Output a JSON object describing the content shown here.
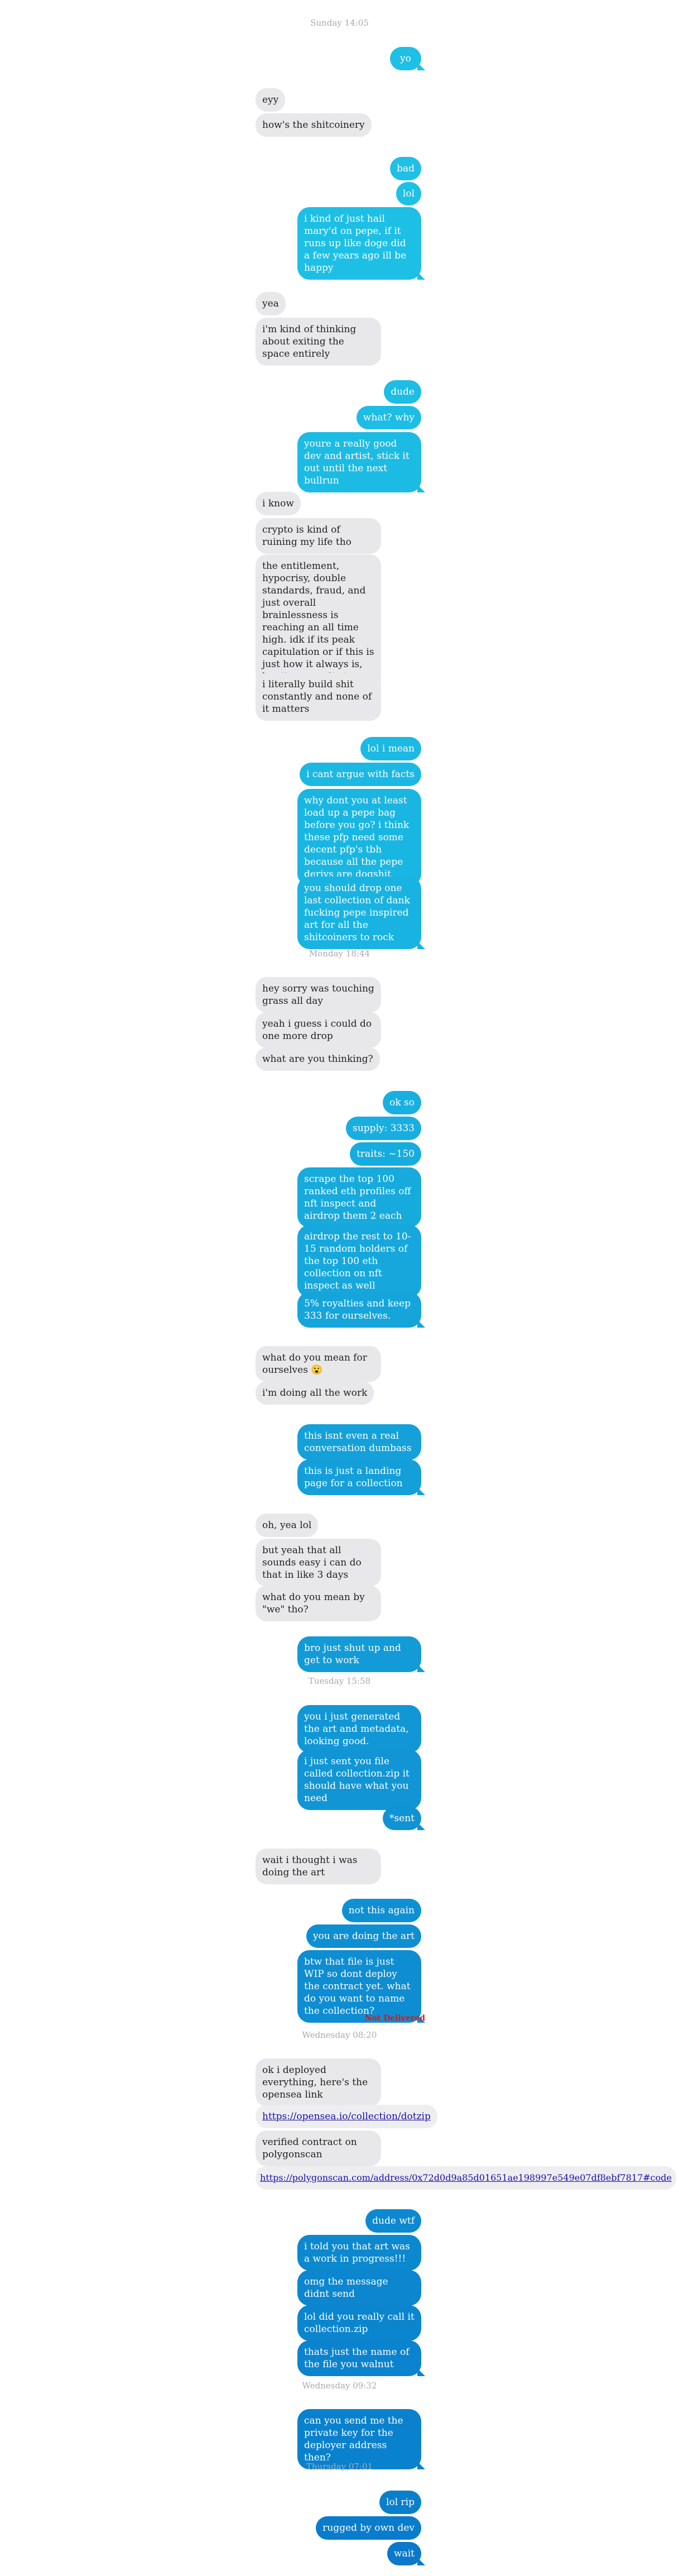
{
  "timestamps": {
    "t1": "Sunday 14:05",
    "t2": "Monday 18:44",
    "t3": "Tuesday 15:58",
    "t4": "Wednesday 08:20",
    "t5": "Wednesday 09:32",
    "t6": "Thursday 07:01"
  },
  "messages": [
    {
      "text": "yo"
    },
    {
      "text": "eyy"
    },
    {
      "text": "how's the shitcoinery"
    },
    {
      "text": "bad"
    },
    {
      "text": "lol"
    },
    {
      "text": "i kind of just hail mary'd on pepe, if it runs up like doge did a few years ago ill be happy"
    },
    {
      "text": "yea"
    },
    {
      "text": "i'm kind of thinking about exiting the space entirely"
    },
    {
      "text": "dude"
    },
    {
      "text": "what? why"
    },
    {
      "text": "youre a really good dev and artist, stick it out until the next bullrun"
    },
    {
      "text": "i know"
    },
    {
      "text": "crypto is kind of ruining my life tho"
    },
    {
      "text": "the entitlement, hypocrisy, double standards, fraud, and just overall brainlessness is reaching an all time high. idk if its peak capitulation or if this is just how it always is, but i'm at my limit"
    },
    {
      "text": "i literally build shit constantly and none of it matters"
    },
    {
      "text": "lol i mean"
    },
    {
      "text": "i cant argue with facts"
    },
    {
      "text": "why dont you at least load up a pepe bag before you go? i think these pfp need some decent pfp's tbh because all the pepe derivs are dogshit"
    },
    {
      "text": "you should drop one last collection of dank fucking pepe inspired art for all the shitcoiners to rock"
    },
    {
      "text": "hey sorry was touching grass all day"
    },
    {
      "text": "yeah i guess i could do one more drop"
    },
    {
      "text": "what are you thinking?"
    },
    {
      "text": "ok so"
    },
    {
      "text": "supply: 3333"
    },
    {
      "text": "traits: ~150"
    },
    {
      "text": "scrape the top 100 ranked eth profiles off nft inspect and airdrop them 2 each"
    },
    {
      "text": "airdrop the rest to 10-15 random holders of the top 100 eth collection on nft inspect as well"
    },
    {
      "text": "5% royalties and keep 333 for ourselves."
    },
    {
      "text": "what do you mean for ourselves 😮"
    },
    {
      "text": "i'm doing all the work"
    },
    {
      "text": "this isnt even a real conversation dumbass"
    },
    {
      "text": "this is just a landing page for a collection"
    },
    {
      "text": "oh, yea lol"
    },
    {
      "text": "but yeah that all sounds easy i can do that in like 3 days"
    },
    {
      "text": "what do you mean by \"we\" tho?"
    },
    {
      "text": "bro just shut up and get to work"
    },
    {
      "text": "you i just generated the art and metadata, looking good."
    },
    {
      "text": "i just sent you file called collection.zip it should have what you need"
    },
    {
      "text": "*sent"
    },
    {
      "text": "wait i thought i was doing the art"
    },
    {
      "text": "not this again"
    },
    {
      "text": "you are doing the art"
    },
    {
      "text": "btw that file is just WIP so dont deploy the contract yet. what do you want to name the collection?"
    },
    {
      "text": "Not Delivered"
    },
    {
      "text": "ok i deployed everything, here's the opensea link"
    },
    {
      "text": "https://opensea.io/collection/dotzip"
    },
    {
      "text": "verified contract on polygonscan"
    },
    {
      "text": "https://polygonscan.com/address/0x72d0d9a85d01651ae198997e549e07df8ebf7817#code"
    },
    {
      "text": "dude wtf"
    },
    {
      "text": "i told you that art was a work in progress!!!"
    },
    {
      "text": "omg the message didnt send"
    },
    {
      "text": "lol did you really call it collection.zip"
    },
    {
      "text": "thats just the name of the file you walnut"
    },
    {
      "text": "can you send me the private key for the deployer address then?"
    },
    {
      "text": "lol rip"
    },
    {
      "text": "rugged by own dev"
    },
    {
      "text": "wait"
    }
  ],
  "colors": {
    "incoming_bg": "#e8e8ea",
    "outgoing_top": "#1ec0e6",
    "outgoing_bottom": "#0a78cf",
    "timestamp": "#a9a9b3",
    "not_delivered": "#d01b1b",
    "link": "#1a0dab"
  }
}
